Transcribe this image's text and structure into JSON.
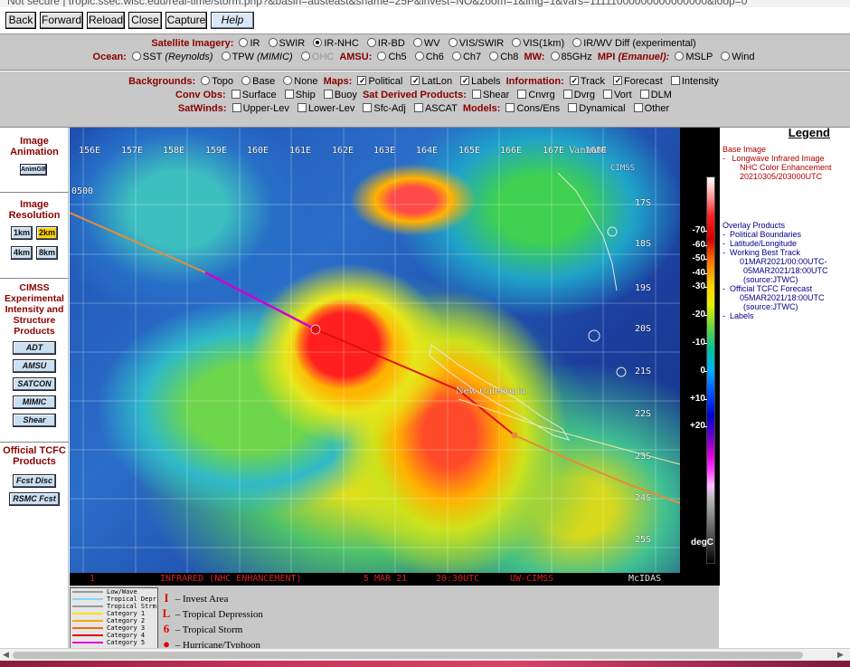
{
  "browser": {
    "url": "Not secure  |  tropic.ssec.wisc.edu/real-time/storm.php?&basin=austeast&sname=25P&invest=NO&zoom=1&img=1&vars=11111000000000000000&loop=0"
  },
  "nav": {
    "back": "Back",
    "forward": "Forward",
    "reload": "Reload",
    "close": "Close",
    "capture": "Capture",
    "help": "Help"
  },
  "imagery": {
    "label": "Satellite Imagery:",
    "options": [
      "IR",
      "SWIR",
      "IR-NHC",
      "IR-BD",
      "WV",
      "VIS/SWIR",
      "VIS(1km)",
      "IR/WV Diff (experimental)"
    ],
    "selected": "IR-NHC"
  },
  "ocean": {
    "label": "Ocean:",
    "sst": "SST",
    "sst_sub": "(Reynolds)",
    "tpw": "TPW",
    "tpw_sub": "(MIMIC)",
    "ohc": "OHC",
    "amsu_label": "AMSU:",
    "amsu": [
      "Ch5",
      "Ch6",
      "Ch7",
      "Ch8"
    ],
    "mw_label": "MW:",
    "mw": "85GHz",
    "mpi_label": "MPI",
    "mpi_sub": "(Emanuel):",
    "mslp": "MSLP",
    "wind": "Wind"
  },
  "backgrounds": {
    "label": "Backgrounds:",
    "topo": "Topo",
    "base": "Base",
    "none": "None"
  },
  "maps": {
    "label": "Maps:",
    "political": "Political",
    "latlon": "LatLon",
    "labels": "Labels"
  },
  "information": {
    "label": "Information:",
    "track": "Track",
    "forecast": "Forecast",
    "intensity": "Intensity"
  },
  "convobs": {
    "label": "Conv Obs:",
    "surface": "Surface",
    "ship": "Ship",
    "buoy": "Buoy"
  },
  "satderived": {
    "label": "Sat Derived Products:",
    "shear": "Shear",
    "cnvrg": "Cnvrg",
    "dvrg": "Dvrg",
    "vort": "Vort",
    "dlm": "DLM"
  },
  "satwinds": {
    "label": "SatWinds:",
    "upper": "Upper-Lev",
    "lower": "Lower-Lev",
    "sfc": "Sfc-Adj",
    "ascat": "ASCAT"
  },
  "models": {
    "label": "Models:",
    "cons": "Cons/Ens",
    "dyn": "Dynamical",
    "other": "Other"
  },
  "sidebar": {
    "animation_title": "Image Animation",
    "animgif": "AnimGIF",
    "resolution_title": "Image Resolution",
    "res": [
      "1km",
      "2km",
      "4km",
      "8km"
    ],
    "cimss_title": "CIMSS Experimental Intensity and Structure Products",
    "cimss_buttons": [
      "ADT",
      "AMSU",
      "SATCON",
      "MIMIC",
      "Shear"
    ],
    "tcfc_title": "Official TCFC Products",
    "tcfc_buttons": [
      "Fcst Disc",
      "RSMC Fcst"
    ]
  },
  "satellite": {
    "lon_labels": [
      "156E",
      "157E",
      "158E",
      "159E",
      "160E",
      "161E",
      "162E",
      "163E",
      "164E",
      "165E",
      "166E",
      "167E",
      "168E"
    ],
    "lat_labels": [
      "17S",
      "18S",
      "19S",
      "20S",
      "21S",
      "22S",
      "23S",
      "24S",
      "25S"
    ],
    "time_marker": "0500",
    "place": "New Caledonia",
    "place_top": "Vanuatu",
    "logo": "CIMSS",
    "footer": {
      "num": "1",
      "product": "INFRARED (NHC ENHANCEMENT)",
      "date": "5 MAR 21",
      "time": "20:30UTC",
      "org": "UW-CIMSS",
      "brand": "McIDAS"
    }
  },
  "colorbar": {
    "ticks": [
      "-70",
      "-60",
      "-50",
      "-40",
      "-30",
      "-20",
      "-10",
      "0",
      "+10",
      "+20"
    ],
    "unit": "degC"
  },
  "legend": {
    "title": "Legend",
    "base_header": "Base Image",
    "base_item": "Longwave Infrared Image",
    "base_sub": "NHC Color Enhancement",
    "base_time": "20210305/203000UTC",
    "overlay_header": "Overlay Products",
    "overlay_items": [
      "Political Boundaries",
      "Latitude/Longitude",
      "Working Best Track"
    ],
    "wbt_range": "01MAR2021/00:00UTC-",
    "wbt_range2": "05MAR2021/18:00UTC",
    "wbt_source": "(source:JTWC)",
    "forecast_item": "Official TCFC Forecast",
    "forecast_time": "05MAR2021/18:00UTC",
    "forecast_source": "(source:JTWC)",
    "labels_item": "Labels"
  },
  "key": {
    "lines": [
      "Low/Wave",
      "Tropical Depr",
      "Tropical Strm",
      "Category 1",
      "Category 2",
      "Category 3",
      "Category 4",
      "Category 5"
    ],
    "symbols": [
      {
        "sym": "I",
        "label": "– Invest Area"
      },
      {
        "sym": "L",
        "label": "– Tropical Depression"
      },
      {
        "sym": "6",
        "label": "– Tropical Storm"
      },
      {
        "sym": "●",
        "label": "– Hurricane/Typhoon"
      }
    ]
  },
  "colors": {
    "accent_red": "#8b0000",
    "button_blue": "#c9dff2",
    "active_res": "#ffd200",
    "track_red": "#e01010",
    "track_magenta": "#d000d0",
    "forecast_orange": "#e88a3a"
  }
}
